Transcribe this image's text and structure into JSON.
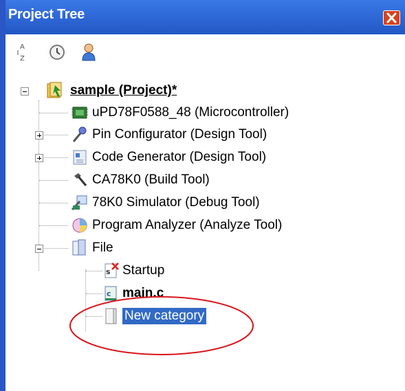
{
  "panel": {
    "title": "Project Tree",
    "close_icon": "close-icon"
  },
  "toolbar": {
    "buttons": [
      {
        "name": "sort-az-button",
        "icon": "sort-alpha-icon"
      },
      {
        "name": "history-button",
        "icon": "clock-icon"
      },
      {
        "name": "user-button",
        "icon": "person-icon"
      }
    ]
  },
  "tree": {
    "project": {
      "label": "sample (Project)*",
      "icon": "project-icon"
    },
    "items": [
      {
        "label": "uPD78F0588_48 (Microcontroller)",
        "icon": "microcontroller-icon"
      },
      {
        "label": "Pin Configurator (Design Tool)",
        "icon": "pin-configurator-icon"
      },
      {
        "label": "Code Generator (Design Tool)",
        "icon": "code-generator-icon"
      },
      {
        "label": "CA78K0 (Build Tool)",
        "icon": "hammer-icon"
      },
      {
        "label": "78K0 Simulator (Debug Tool)",
        "icon": "simulator-icon"
      },
      {
        "label": "Program Analyzer (Analyze Tool)",
        "icon": "analyzer-icon"
      },
      {
        "label": "File",
        "icon": "folder-icon"
      }
    ],
    "file_children": [
      {
        "label": "Startup",
        "icon": "startup-file-icon"
      },
      {
        "label": "main.c",
        "icon": "c-file-icon"
      },
      {
        "label": "New category",
        "icon": "category-icon"
      }
    ]
  },
  "colors": {
    "title_bar": "#2257c5",
    "selection": "#316ac5",
    "annotation": "#d9141b"
  }
}
